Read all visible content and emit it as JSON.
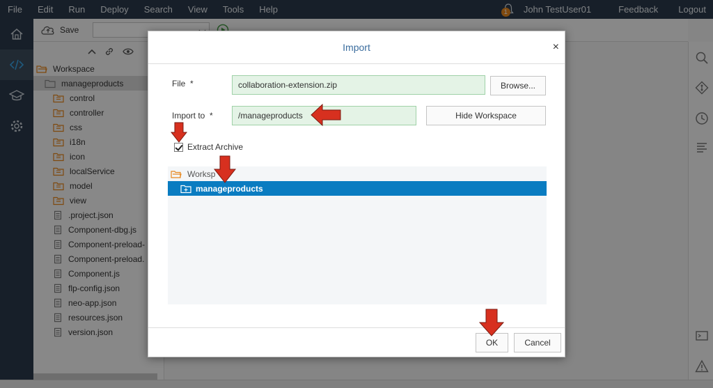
{
  "menubar": {
    "items": [
      "File",
      "Edit",
      "Run",
      "Deploy",
      "Search",
      "View",
      "Tools",
      "Help"
    ],
    "notification_count": "1",
    "user": "John TestUser01",
    "feedback": "Feedback",
    "logout": "Logout"
  },
  "toolbar": {
    "save_label": "Save"
  },
  "workspace_tree": {
    "root": "Workspace",
    "project": "manageproducts",
    "folders": [
      "control",
      "controller",
      "css",
      "i18n",
      "icon",
      "localService",
      "model",
      "view"
    ],
    "files": [
      ".project.json",
      "Component-dbg.js",
      "Component-preload-",
      "Component-preload.",
      "Component.js",
      "flp-config.json",
      "neo-app.json",
      "resources.json",
      "version.json"
    ]
  },
  "dialog": {
    "title": "Import",
    "close_glyph": "×",
    "file_label": "File",
    "required_mark": "*",
    "file_value": "collaboration-extension.zip",
    "browse_label": "Browse...",
    "import_to_label": "Import to",
    "import_to_value": "/manageproducts",
    "hide_workspace_label": "Hide Workspace",
    "extract_archive_label": "Extract Archive",
    "extract_archive_checked": true,
    "tree_root": "Worksp",
    "tree_selected": "manageproducts",
    "ok_label": "OK",
    "cancel_label": "Cancel"
  },
  "colors": {
    "menubar_bg": "#2a3a4b",
    "accent": "#0a7cc1",
    "field_bg": "#e4f3e6",
    "arrow_red": "#d7301f",
    "folder_orange": "#e8871e"
  }
}
